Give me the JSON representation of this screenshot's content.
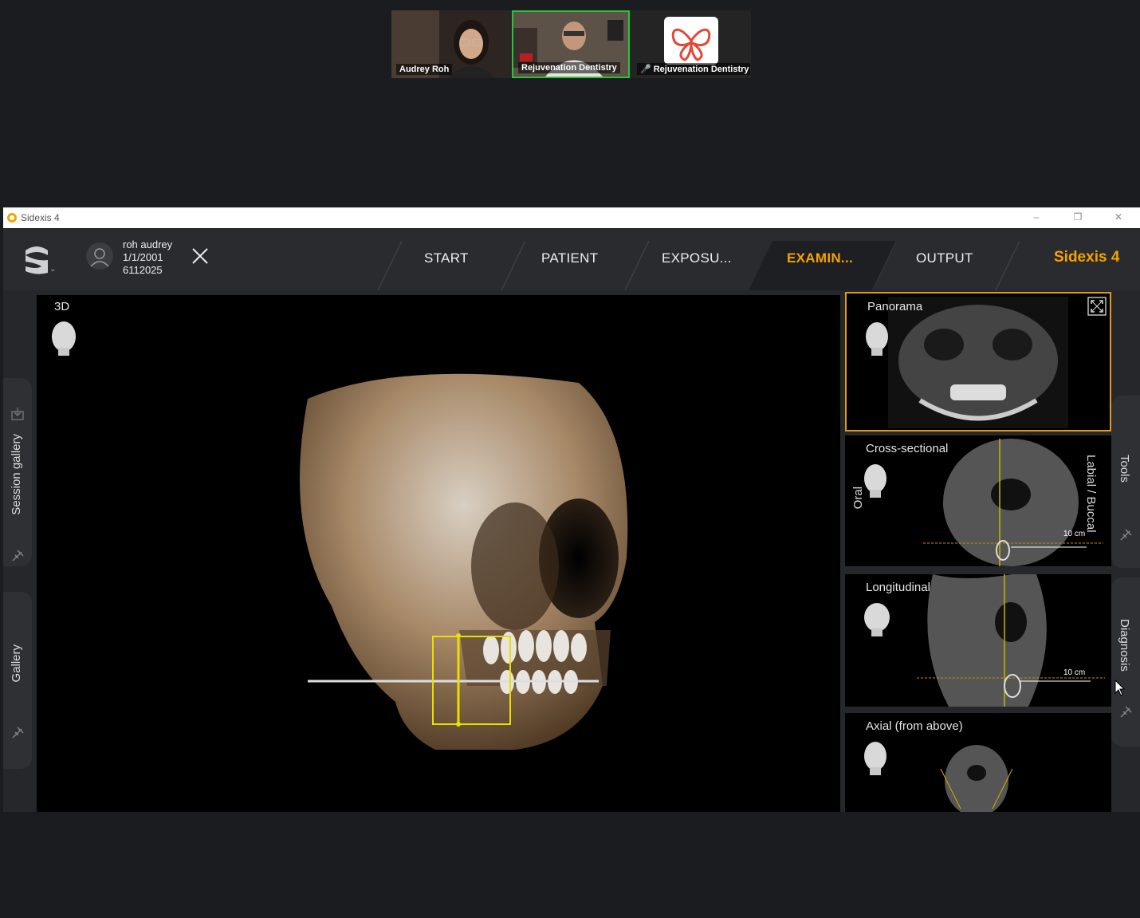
{
  "call": {
    "participants": [
      {
        "name": "Audrey Roh",
        "muted": false
      },
      {
        "name": "Rejuvenation Dentistry",
        "muted": false,
        "speaking": true
      },
      {
        "name": "Rejuvenation Dentistry",
        "muted": true
      }
    ]
  },
  "window": {
    "title": "Sidexis 4",
    "controls": {
      "minimize": "–",
      "restore": "❐",
      "close": "✕"
    }
  },
  "patient": {
    "name": "roh  audrey",
    "dob": "1/1/2001",
    "id": "6112025"
  },
  "nav": {
    "tabs": [
      "START",
      "PATIENT",
      "EXPOSU...",
      "EXAMIN...",
      "OUTPUT"
    ],
    "active_tab": "EXAMIN...",
    "brand": "Sidexis 4"
  },
  "left_panel": {
    "session_gallery": "Session gallery",
    "gallery": "Gallery"
  },
  "right_panel": {
    "tools": "Tools",
    "diagnosis": "Diagnosis"
  },
  "main_view": {
    "label": "3D"
  },
  "thumbnails": {
    "panorama": {
      "label": "Panorama"
    },
    "cross_sectional": {
      "label": "Cross-sectional",
      "left_orientation": "Oral",
      "right_orientation": "Labial / Buccal",
      "scale": "10 cm"
    },
    "longitudinal": {
      "label": "Longitudinal",
      "scale": "10 cm"
    },
    "axial": {
      "label": "Axial (from above)"
    }
  },
  "colors": {
    "accent": "#f5a300",
    "speaking_border": "#27c43a"
  },
  "icons": [
    "head-icon",
    "expand-icon",
    "pin-icon",
    "import-icon",
    "close-icon",
    "avatar-icon"
  ]
}
